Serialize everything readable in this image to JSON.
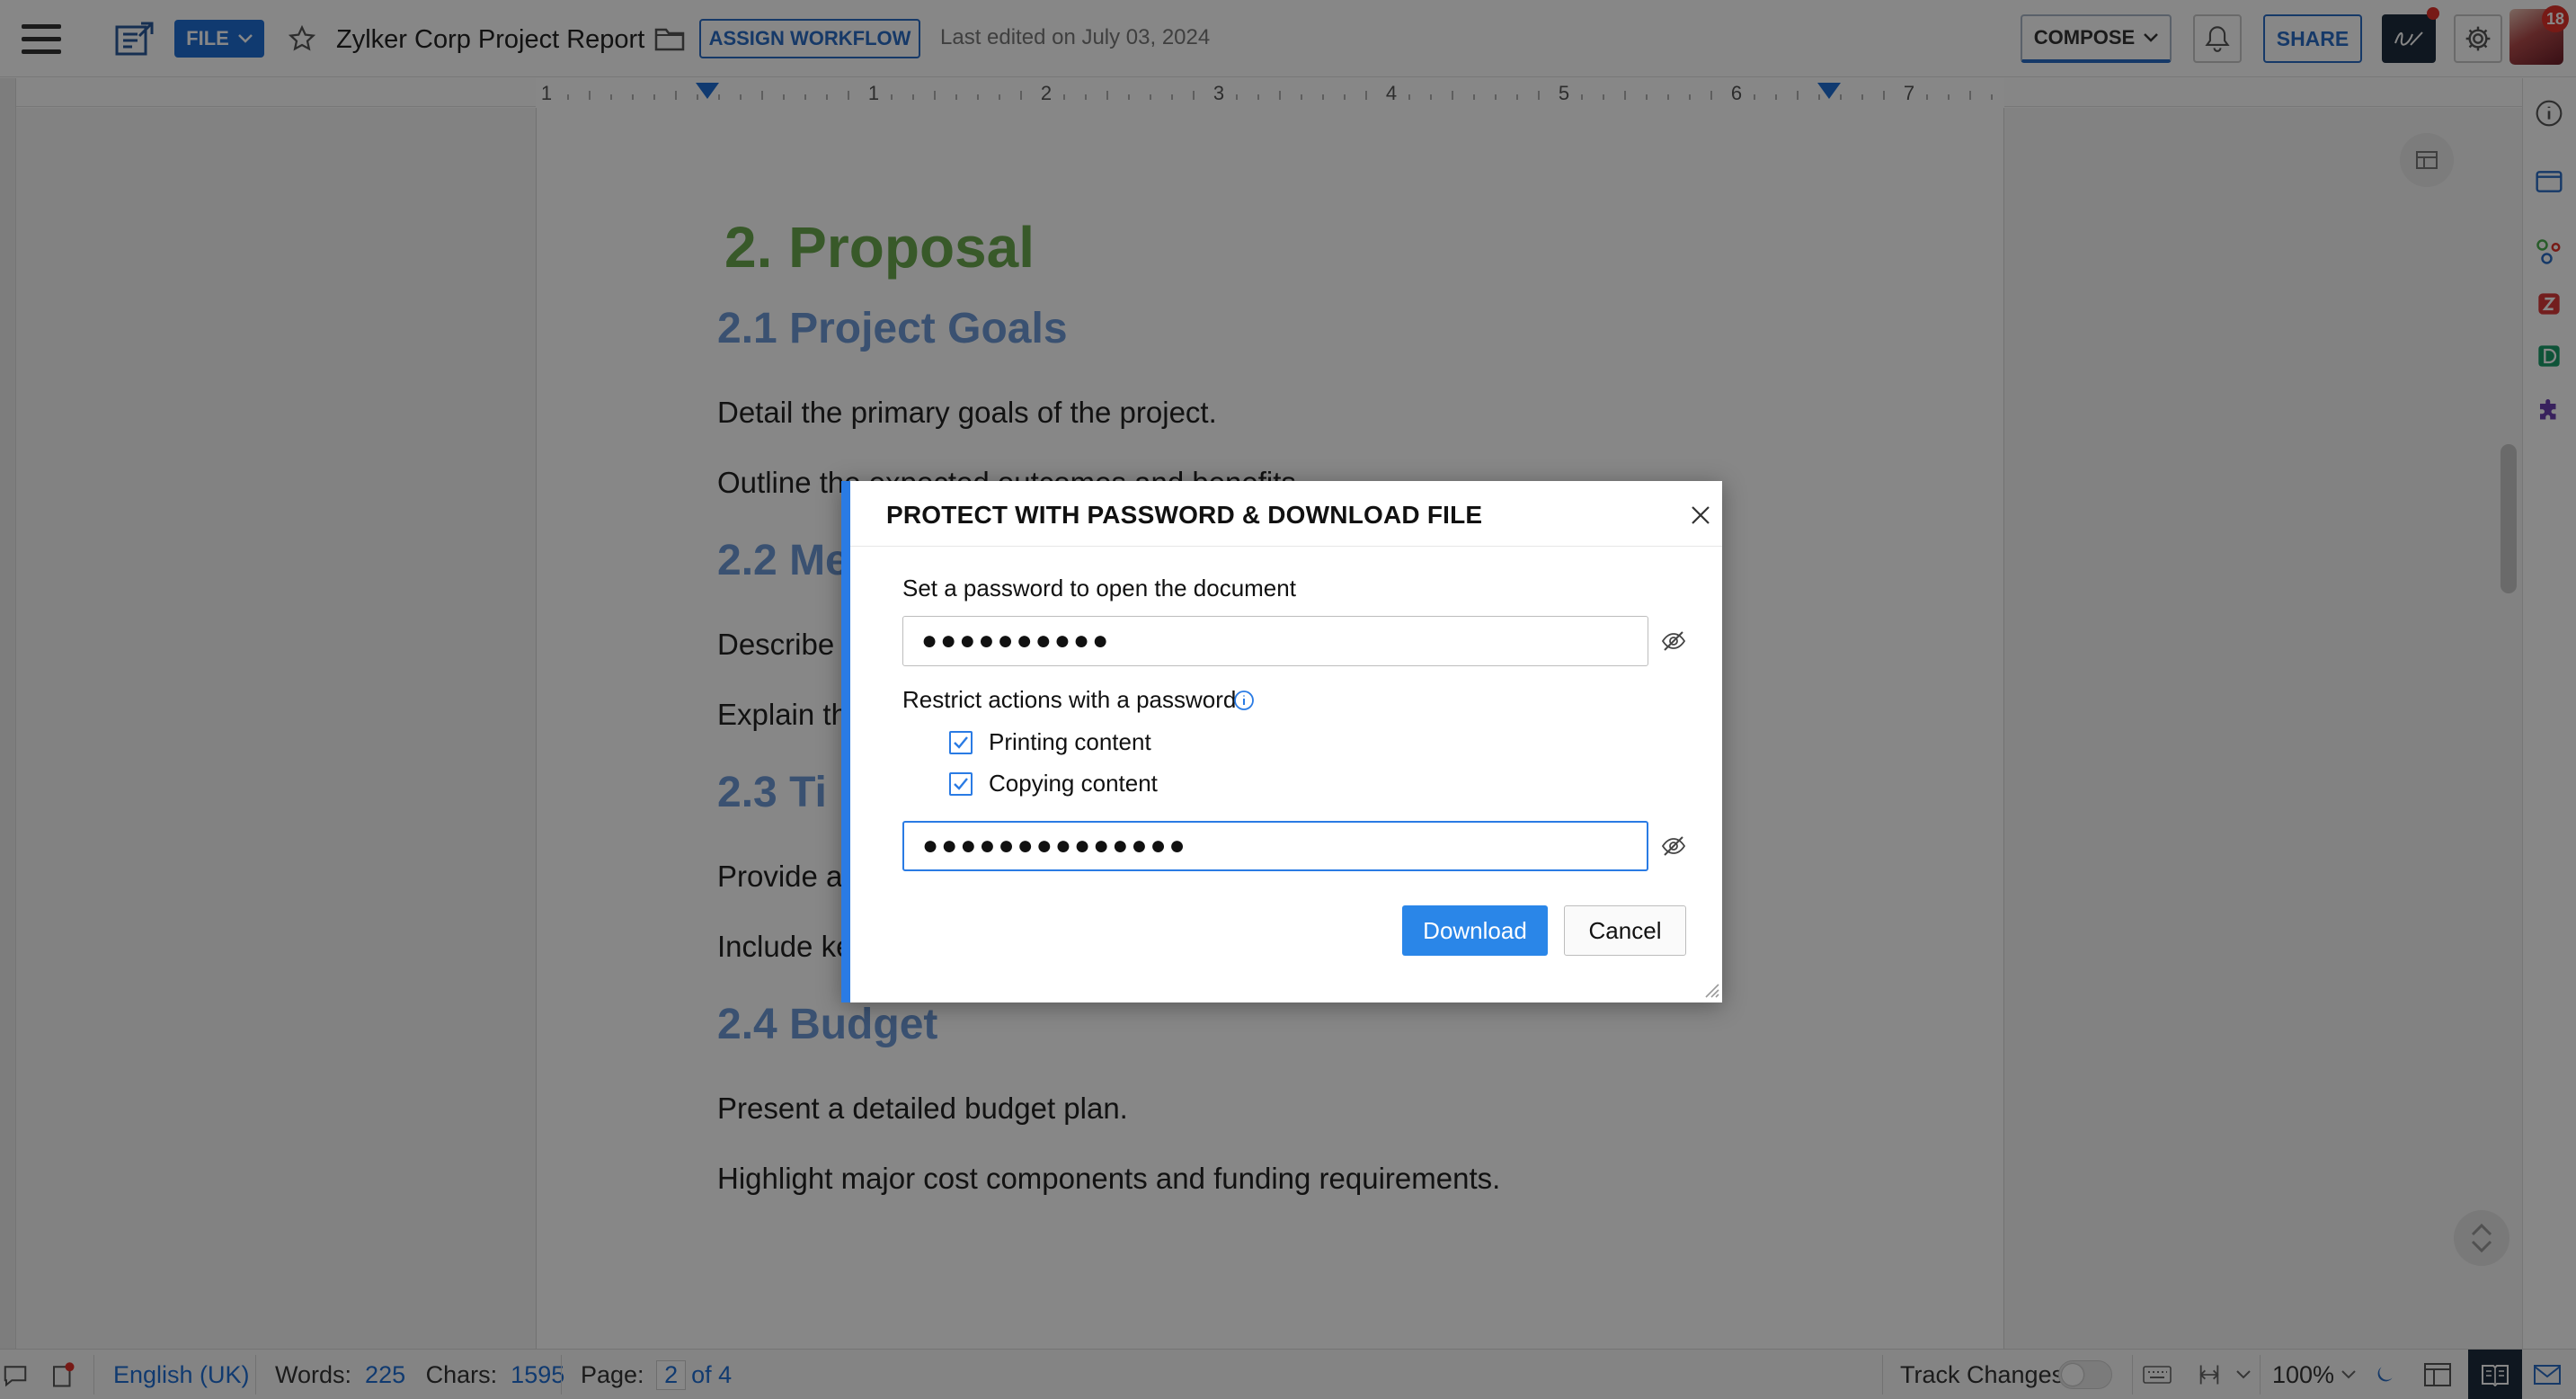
{
  "header": {
    "file_label": "FILE",
    "doc_title": "Zylker Corp Project Report",
    "assign_workflow_label": "ASSIGN WORKFLOW",
    "last_edited": "Last edited on July 03, 2024",
    "compose_label": "COMPOSE",
    "share_label": "SHARE",
    "avatar_badge": "18"
  },
  "ruler": {
    "ticks": [
      "1",
      "1",
      "2",
      "3",
      "4",
      "5",
      "6",
      "7"
    ]
  },
  "document": {
    "h1": "2. Proposal",
    "s1_heading": "2.1 Project Goals",
    "s1_p1": "Detail the primary goals of the project.",
    "s1_p2": "Outline the expected outcomes and benefits.",
    "s2_heading": "2.2 Me",
    "s2_p1": "Describe t",
    "s2_p2": "Explain th",
    "s3_heading": "2.3 Ti",
    "s3_p1": "Provide a",
    "s3_p2": "Include ke",
    "s4_heading": "2.4 Budget",
    "s4_p1": "Present a detailed budget plan.",
    "s4_p2": "Highlight major cost components and funding requirements."
  },
  "dialog": {
    "title": "PROTECT WITH PASSWORD & DOWNLOAD FILE",
    "open_password_label": "Set a password to open the document",
    "open_password_value": "●●●●●●●●●●",
    "restrict_label": "Restrict actions with a password",
    "printing_label": "Printing content",
    "copying_label": "Copying content",
    "restrict_password_value": "●●●●●●●●●●●●●●",
    "download_label": "Download",
    "cancel_label": "Cancel"
  },
  "statusbar": {
    "language": "English (UK)",
    "words_label": "Words:",
    "words_value": "225",
    "chars_label": "Chars:",
    "chars_value": "1595",
    "page_label": "Page:",
    "page_current": "2",
    "page_total": "of 4",
    "track_changes_label": "Track Changes",
    "zoom": "100%"
  },
  "colors": {
    "accent": "#1f6ed4",
    "heading1": "#6aa84f",
    "heading2": "#6f9ad6",
    "download_button": "#2a86e8"
  },
  "icons": [
    "menu-icon",
    "docs-app-icon",
    "chevron-down-icon",
    "star-icon",
    "folder-icon",
    "bell-icon",
    "signature-icon",
    "gear-icon",
    "info-icon",
    "close-icon",
    "eye-off-icon",
    "checkbox-checked-icon",
    "comment-icon",
    "moon-icon",
    "keyboard-icon",
    "mail-icon"
  ]
}
